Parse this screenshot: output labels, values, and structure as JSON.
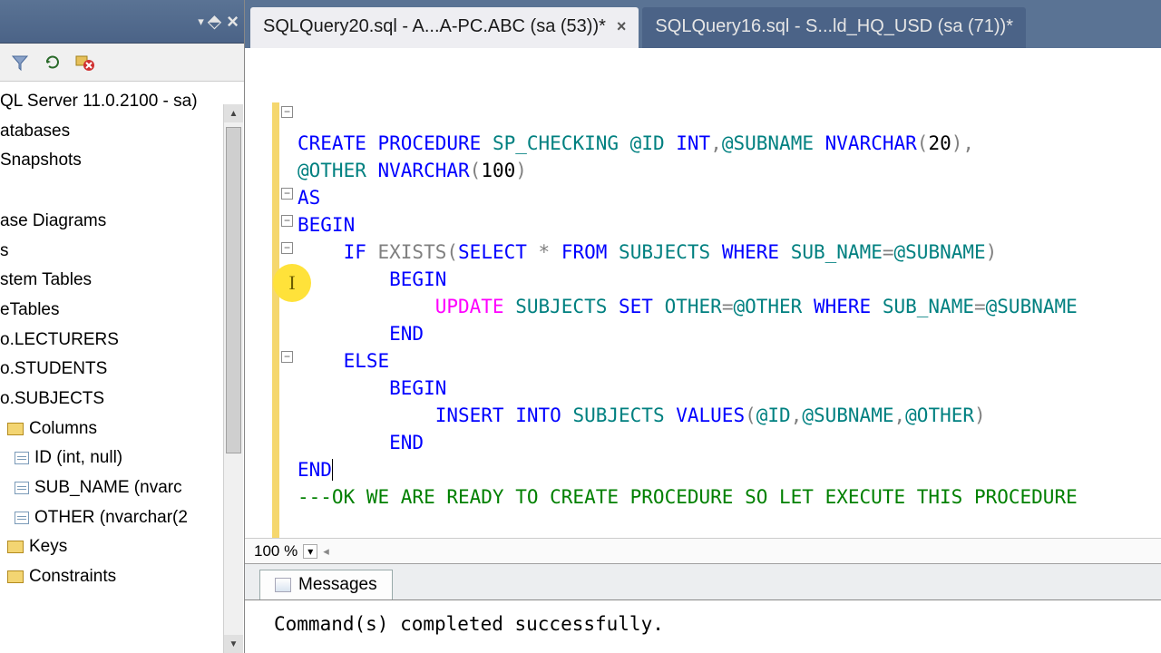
{
  "tabs": {
    "active": "SQLQuery20.sql - A...A-PC.ABC (sa (53))*",
    "inactive": "SQLQuery16.sql - S...ld_HQ_USD (sa (71))*"
  },
  "tree": {
    "server": "QL Server 11.0.2100 - sa)",
    "databases": "atabases",
    "snapshots": "Snapshots",
    "diagrams": "ase Diagrams",
    "s": "s",
    "system_tables": "stem Tables",
    "etables": "eTables",
    "lecturers": "o.LECTURERS",
    "students": "o.STUDENTS",
    "subjects": "o.SUBJECTS",
    "columns": "Columns",
    "col_id": "ID (int, null)",
    "col_subname": "SUB_NAME (nvarc",
    "col_other": "OTHER (nvarchar(2",
    "keys": "Keys",
    "constraints": "Constraints"
  },
  "zoom": "100 %",
  "messages_tab": "Messages",
  "messages_body": "Command(s) completed successfully.",
  "code": {
    "l1_a": "CREATE",
    "l1_b": " PROCEDURE",
    "l1_c": " SP_CHECKING ",
    "l1_d": "@ID",
    "l1_e": " INT",
    "l1_f": ",",
    "l1_g": "@SUBNAME",
    "l1_h": " NVARCHAR",
    "l1_i": "(",
    "l1_j": "20",
    "l1_k": ")",
    "l1_l": ",",
    "l2_a": "@OTHER",
    "l2_b": " NVARCHAR",
    "l2_c": "(",
    "l2_d": "100",
    "l2_e": ")",
    "l3_a": "AS",
    "l4_a": "BEGIN",
    "l5_a": "    IF",
    "l5_b": " EXISTS",
    "l5_c": "(",
    "l5_d": "SELECT",
    "l5_e": " *",
    "l5_f": " FROM",
    "l5_g": " SUBJECTS ",
    "l5_h": "WHERE",
    "l5_i": " SUB_NAME",
    "l5_j": "=",
    "l5_k": "@SUBNAME",
    "l5_l": ")",
    "l6_a": "        BEGIN",
    "l7_a": "            UPDATE",
    "l7_b": " SUBJECTS ",
    "l7_c": "SET",
    "l7_d": " OTHER",
    "l7_e": "=",
    "l7_f": "@OTHER",
    "l7_g": " WHERE",
    "l7_h": " SUB_NAME",
    "l7_i": "=",
    "l7_j": "@SUBNAME",
    "l8_a": "        END",
    "l9_a": "    ELSE",
    "l10_a": "        BEGIN",
    "l11_a": "            INSERT",
    "l11_b": " INTO",
    "l11_c": " SUBJECTS ",
    "l11_d": "VALUES",
    "l11_e": "(",
    "l11_f": "@ID",
    "l11_g": ",",
    "l11_h": "@SUBNAME",
    "l11_i": ",",
    "l11_j": "@OTHER",
    "l11_k": ")",
    "l12_a": "        END",
    "l13_a": "END",
    "l14_a": "---OK WE ARE READY TO CREATE PROCEDURE SO LET EXECUTE THIS PROCEDURE"
  }
}
